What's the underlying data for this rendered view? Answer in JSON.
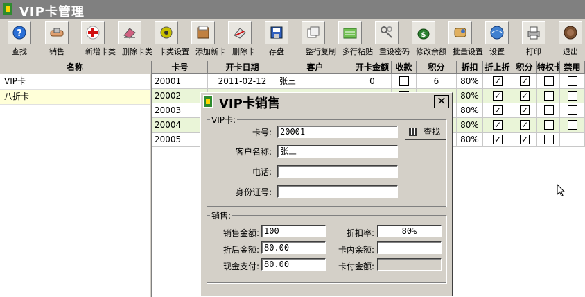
{
  "window": {
    "title": "VIP卡管理"
  },
  "toolbar": {
    "items": [
      {
        "label": "查找",
        "icon": "help-search-icon"
      },
      {
        "label": "销售",
        "icon": "handshake-icon"
      },
      {
        "label": "新增卡类",
        "icon": "red-cross-add-icon"
      },
      {
        "label": "删除卡类",
        "icon": "eraser-delete-icon"
      },
      {
        "label": "卡类设置",
        "icon": "gear-settings-icon"
      },
      {
        "label": "添加新卡",
        "icon": "card-file-icon"
      },
      {
        "label": "删除卡",
        "icon": "delete-card-icon"
      },
      {
        "label": "存盘",
        "icon": "floppy-save-icon"
      },
      {
        "label": "整行复制",
        "icon": "copy-row-icon"
      },
      {
        "label": "多行粘贴",
        "icon": "paste-rows-icon"
      },
      {
        "label": "重设密码",
        "icon": "keys-icon"
      },
      {
        "label": "修改余额",
        "icon": "money-bag-icon"
      },
      {
        "label": "批量设置",
        "icon": "batch-settings-icon"
      },
      {
        "label": "设置",
        "icon": "settings-globe-icon"
      },
      {
        "label": "打印",
        "icon": "printer-icon"
      },
      {
        "label": "退出",
        "icon": "exit-icon"
      }
    ]
  },
  "left_panel": {
    "header": "名称",
    "items": [
      "VIP卡",
      "八折卡"
    ]
  },
  "grid": {
    "columns": [
      "卡号",
      "开卡日期",
      "客户",
      "开卡金额",
      "收款",
      "积分",
      "折扣",
      "折上折",
      "积分",
      "特权卡",
      "禁用"
    ],
    "rows": [
      {
        "card_no": "20001",
        "date": "2011-02-12",
        "customer": "张三",
        "amount": "0",
        "collected": false,
        "points": "6",
        "discount": "80%",
        "double_discount": true,
        "points_flag": true,
        "privilege": false,
        "disabled": false
      },
      {
        "card_no": "20002",
        "date": "",
        "customer": "",
        "amount": "",
        "collected": false,
        "points": "",
        "discount": "80%",
        "double_discount": true,
        "points_flag": true,
        "privilege": false,
        "disabled": false
      },
      {
        "card_no": "20003",
        "date": "",
        "customer": "",
        "amount": "",
        "collected": false,
        "points": "",
        "discount": "80%",
        "double_discount": true,
        "points_flag": true,
        "privilege": false,
        "disabled": false
      },
      {
        "card_no": "20004",
        "date": "",
        "customer": "",
        "amount": "",
        "collected": false,
        "points": "",
        "discount": "80%",
        "double_discount": true,
        "points_flag": true,
        "privilege": false,
        "disabled": false
      },
      {
        "card_no": "20005",
        "date": "",
        "customer": "",
        "amount": "",
        "collected": false,
        "points": "",
        "discount": "80%",
        "double_discount": true,
        "points_flag": true,
        "privilege": false,
        "disabled": false
      }
    ]
  },
  "dialog": {
    "title": "VIP卡销售",
    "close_label": "✕",
    "vip_group": {
      "legend": "VIP卡:",
      "card_no_label": "卡号:",
      "card_no_value": "20001",
      "find_label": "查找",
      "customer_label": "客户名称:",
      "customer_value": "张三",
      "phone_label": "电话:",
      "phone_value": "",
      "id_label": "身份证号:",
      "id_value": ""
    },
    "sale_group": {
      "legend": "销售:",
      "sale_amount_label": "销售金额:",
      "sale_amount_value": "100",
      "discount_rate_label": "折扣率:",
      "discount_rate_value": "80%",
      "after_discount_label": "折后金额:",
      "after_discount_value": "80.00",
      "card_balance_label": "卡内余额:",
      "card_balance_value": "",
      "cash_label": "现金支付:",
      "cash_value": "80.00",
      "card_pay_label": "卡付金额:",
      "card_pay_value": ""
    }
  }
}
